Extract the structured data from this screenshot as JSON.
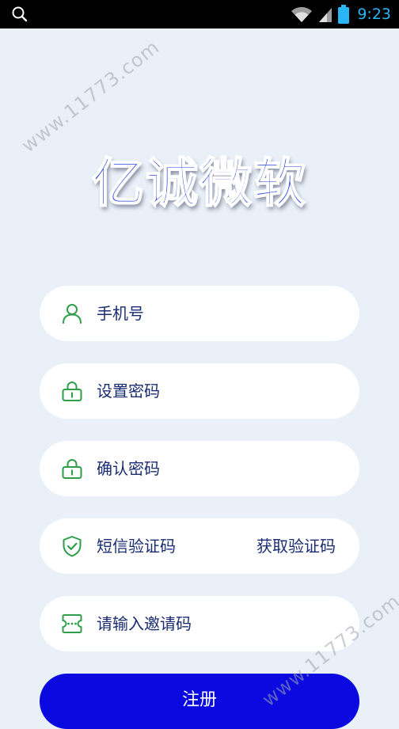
{
  "status_bar": {
    "time": "9:23",
    "icons": [
      "search-icon",
      "wifi-icon",
      "cellular-signal-icon",
      "battery-icon"
    ],
    "time_color": "#29b6f6"
  },
  "logo": {
    "text": "亿诚微软",
    "color": "#1f3fe0"
  },
  "form": {
    "phone_placeholder": "手机号",
    "password_placeholder": "设置密码",
    "confirm_password_placeholder": "确认密码",
    "sms_code_placeholder": "短信验证码",
    "get_code_label": "获取验证码",
    "invite_code_placeholder": "请输入邀请码",
    "icon_color": "#2e9e4a"
  },
  "register_button": {
    "label": "注册",
    "color": "#0a0ae0"
  },
  "watermark": {
    "text": "www.11773.com"
  }
}
